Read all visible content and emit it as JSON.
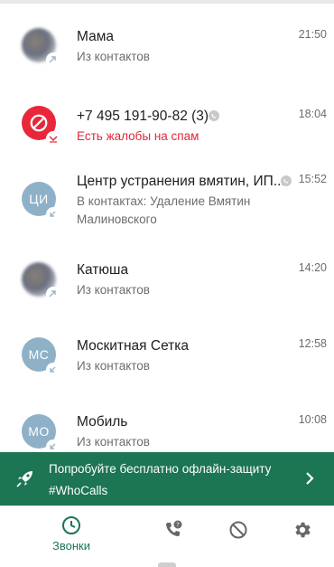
{
  "calls": [
    {
      "name": "Мама",
      "subtitle": "Из контактов",
      "time": "21:50",
      "avatar": "blurred-photo"
    },
    {
      "name": "+7 495 191-90-82 (3)",
      "subtitle": "Есть жалобы на спам",
      "time": "18:04",
      "avatar": "spam-block"
    },
    {
      "name": "Центр устранения вмятин, ИП...",
      "subtitle": "В контактах: Удаление Вмятин Малиновского",
      "time": "15:52",
      "avatar_initials": "ЦИ"
    },
    {
      "name": "Катюша",
      "subtitle": "Из контактов",
      "time": "14:20",
      "avatar": "blurred-photo"
    },
    {
      "name": "Москитная Сетка",
      "subtitle": "Из контактов",
      "time": "12:58",
      "avatar_initials": "МС"
    },
    {
      "name": "Мобиль",
      "subtitle": "Из контактов",
      "time": "10:08",
      "avatar_initials": "МО"
    }
  ],
  "promo": {
    "line1": "Попробуйте бесплатно офлайн-защиту",
    "line2": "#WhoCalls",
    "icon": "rocket-icon"
  },
  "nav": {
    "calls_label": "Звонки",
    "items": [
      "clock-icon",
      "phone-question-icon",
      "block-icon",
      "gear-icon"
    ]
  },
  "colors": {
    "accent": "#1c7553",
    "spam": "#e8283a",
    "avatar": "#8fb1c8"
  }
}
